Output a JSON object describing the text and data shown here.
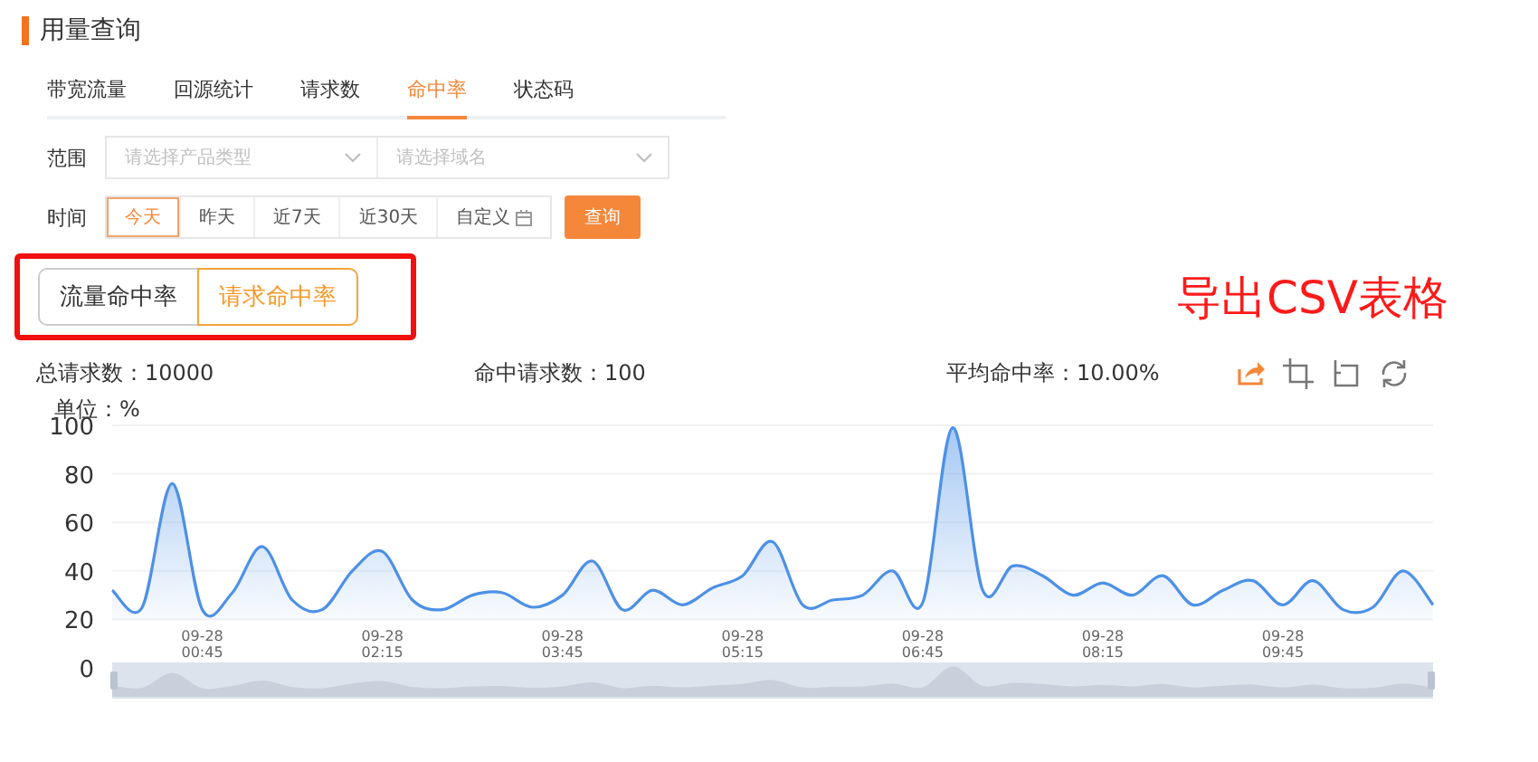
{
  "title": "用量查询",
  "tabs": [
    {
      "label": "带宽流量",
      "selected": false
    },
    {
      "label": "回源统计",
      "selected": false
    },
    {
      "label": "请求数",
      "selected": false
    },
    {
      "label": "命中率",
      "selected": true
    },
    {
      "label": "状态码",
      "selected": false
    }
  ],
  "filters": {
    "scope_label": "范围",
    "selects": [
      {
        "placeholder": "请选择产品类型"
      },
      {
        "placeholder": "请选择域名"
      }
    ],
    "time_label": "时间",
    "time_options": [
      {
        "label": "今天",
        "selected": true
      },
      {
        "label": "昨天",
        "selected": false
      },
      {
        "label": "近7天",
        "selected": false
      },
      {
        "label": "近30天",
        "selected": false
      },
      {
        "label": "自定义",
        "selected": false,
        "kind": "calendar"
      }
    ],
    "query_button": "查询"
  },
  "segments": [
    {
      "label": "流量命中率",
      "selected": false
    },
    {
      "label": "请求命中率",
      "selected": true
    }
  ],
  "annotation": "导出CSV表格",
  "stats": [
    "总请求数：10000",
    "命中请求数：100",
    "平均命中率：10.00%"
  ],
  "chart_data": {
    "type": "area",
    "grid": true,
    "ylabel": "单位：%",
    "ylim": [
      0,
      100
    ],
    "yticks": [
      0,
      20,
      40,
      60,
      80,
      100
    ],
    "categories": [
      null,
      null,
      null,
      "09-28 00:45",
      null,
      null,
      null,
      null,
      null,
      "09-28 02:15",
      null,
      null,
      null,
      null,
      null,
      "09-28 03:45",
      null,
      null,
      null,
      null,
      null,
      "09-28 05:15",
      null,
      null,
      null,
      null,
      null,
      "09-28 06:45",
      null,
      null,
      null,
      null,
      null,
      "09-28 08:15",
      null,
      null,
      null,
      null,
      null,
      "09-28 09:45",
      null,
      null,
      null,
      null,
      null
    ],
    "values": [
      32,
      25,
      76,
      24,
      31,
      50,
      28,
      24,
      40,
      48,
      28,
      24,
      30,
      31,
      25,
      30,
      44,
      24,
      32,
      26,
      33,
      38,
      52,
      26,
      28,
      30,
      40,
      27,
      99,
      32,
      42,
      38,
      30,
      35,
      30,
      38,
      26,
      32,
      36,
      26,
      36,
      24,
      25,
      40,
      26
    ]
  }
}
